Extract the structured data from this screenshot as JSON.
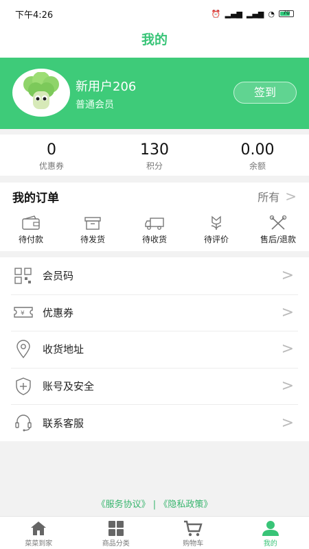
{
  "status_bar": {
    "time": "下午4:26",
    "battery": "70"
  },
  "header": {
    "title": "我的"
  },
  "profile": {
    "name": "新用户206",
    "level": "普通会员",
    "checkin_label": "签到"
  },
  "stats": [
    {
      "value": "0",
      "label": "优惠券"
    },
    {
      "value": "130",
      "label": "积分"
    },
    {
      "value": "0.00",
      "label": "余额"
    }
  ],
  "orders": {
    "title": "我的订单",
    "all_label": "所有",
    "items": [
      {
        "label": "待付款",
        "icon": "wallet-icon"
      },
      {
        "label": "待发货",
        "icon": "box-icon"
      },
      {
        "label": "待收货",
        "icon": "truck-icon"
      },
      {
        "label": "待评价",
        "icon": "flower-icon"
      },
      {
        "label": "售后/退款",
        "icon": "tools-icon"
      }
    ]
  },
  "menu": [
    {
      "label": "会员码",
      "icon": "qrcode-icon"
    },
    {
      "label": "优惠券",
      "icon": "coupon-icon"
    },
    {
      "label": "收货地址",
      "icon": "location-icon"
    },
    {
      "label": "账号及安全",
      "icon": "shield-icon"
    },
    {
      "label": "联系客服",
      "icon": "headset-icon"
    }
  ],
  "links": {
    "service": "《服务协议》",
    "separator": "|",
    "privacy": "《隐私政策》"
  },
  "tabbar": [
    {
      "label": "菜菜到家",
      "icon": "home-icon"
    },
    {
      "label": "商品分类",
      "icon": "grid-icon"
    },
    {
      "label": "购物车",
      "icon": "cart-icon"
    },
    {
      "label": "我的",
      "icon": "user-icon"
    }
  ],
  "colors": {
    "brand": "#3ecb79",
    "title": "#38c477",
    "background": "#f2f2f2"
  }
}
